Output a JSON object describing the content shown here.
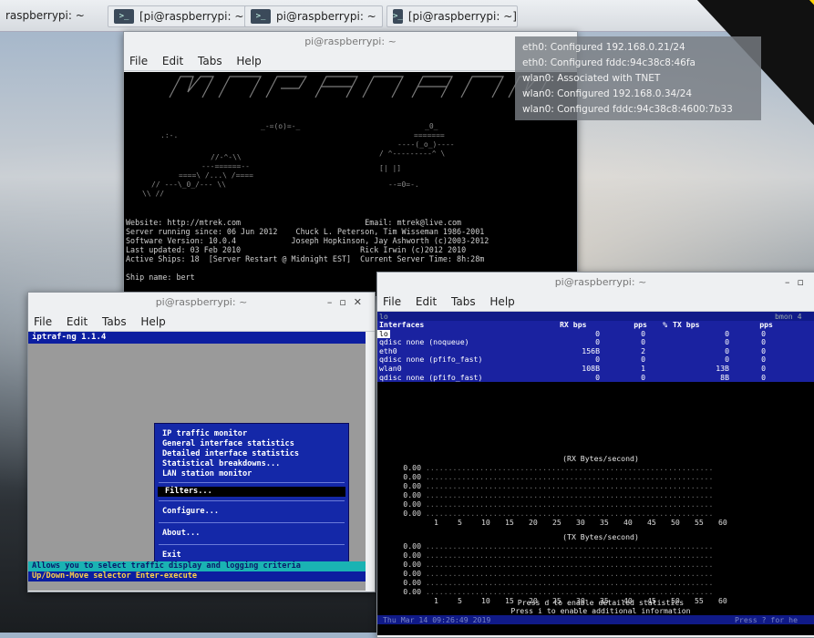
{
  "taskbar": {
    "items": [
      {
        "label": "raspberrypi: ~",
        "icon": "none"
      },
      {
        "label": "[pi@raspberrypi: ~]",
        "icon": "terminal-icon"
      },
      {
        "label": "pi@raspberrypi: ~",
        "icon": "terminal-icon"
      },
      {
        "label": "[pi@raspberrypi: ~]",
        "icon": "terminal-icon"
      }
    ]
  },
  "notification": {
    "lines": [
      "eth0: Configured 192.168.0.21/24",
      "eth0: Configured fddc:94c38c8:46fa",
      "wlan0: Associated with TNET",
      "wlan0: Configured 192.168.0.34/24",
      "wlan0: Configured fddc:94c38c8:4600:7b33"
    ]
  },
  "menu": {
    "file": "File",
    "edit": "Edit",
    "tabs": "Tabs",
    "help": "Help"
  },
  "win_mtrek": {
    "title": "pi@raspberrypi: ~",
    "lines": [
      "Website: http://mtrek.com                           Email: mtrek@live.com",
      "Server running since: 06 Jun 2012    Chuck L. Peterson, Tim Wisseman 1986-2001",
      "Software Version: 10.0.4            Joseph Hopkinson, Jay Ashworth (c)2003-2012",
      "Last updated: 03 Feb 2010                          Rick Irwin (c)2012 2010",
      "Active Ships: 18  [Server Restart @ Midnight EST]  Current Server Time: 8h:28m",
      "",
      "Ship name: bert"
    ]
  },
  "win_iptraf": {
    "title": "pi@raspberrypi: ~",
    "header": "iptraf-ng 1.1.4",
    "menu_items": [
      "IP traffic monitor",
      "General interface statistics",
      "Detailed interface statistics",
      "Statistical breakdowns...",
      "LAN station monitor"
    ],
    "selected": "Filters...",
    "more_items": [
      "Configure...",
      "About...",
      "Exit"
    ],
    "status1": "Allows you to select traffic display and logging criteria",
    "status2": "Up/Down-Move selector  Enter-execute"
  },
  "win_bmon": {
    "title": "pi@raspberrypi: ~",
    "top_left": "lo",
    "top_right": "bmon 4",
    "table_header": [
      "Interfaces",
      "RX bps",
      "pps",
      "%",
      "TX bps",
      "pps"
    ],
    "rows": [
      [
        "lo",
        "0",
        "0",
        "",
        "0",
        "0"
      ],
      [
        "  qdisc none (noqueue)",
        "0",
        "0",
        "",
        "0",
        "0"
      ],
      [
        "eth0",
        "156B",
        "2",
        "",
        "0",
        "0"
      ],
      [
        "  qdisc none (pfifo_fast)",
        "0",
        "0",
        "",
        "0",
        "0"
      ],
      [
        "wlan0",
        "108B",
        "1",
        "",
        "13B",
        "0"
      ],
      [
        "  qdisc none (pfifo_fast)",
        "0",
        "0",
        "",
        "8B",
        "0"
      ]
    ],
    "rx_label": "(RX Bytes/second)",
    "tx_label": "(TX Bytes/second)",
    "y_values": [
      "0.00",
      "0.00",
      "0.00",
      "0.00",
      "0.00",
      "0.00"
    ],
    "x_ticks": [
      "1",
      "5",
      "10",
      "15",
      "20",
      "25",
      "30",
      "35",
      "40",
      "45",
      "50",
      "55",
      "60"
    ],
    "hint1": "Press d to enable detailed statistics",
    "hint2": "Press i to enable additional information",
    "footer_left": "Thu Mar 14 09:26:49 2019",
    "footer_right": "Press ? for he"
  }
}
